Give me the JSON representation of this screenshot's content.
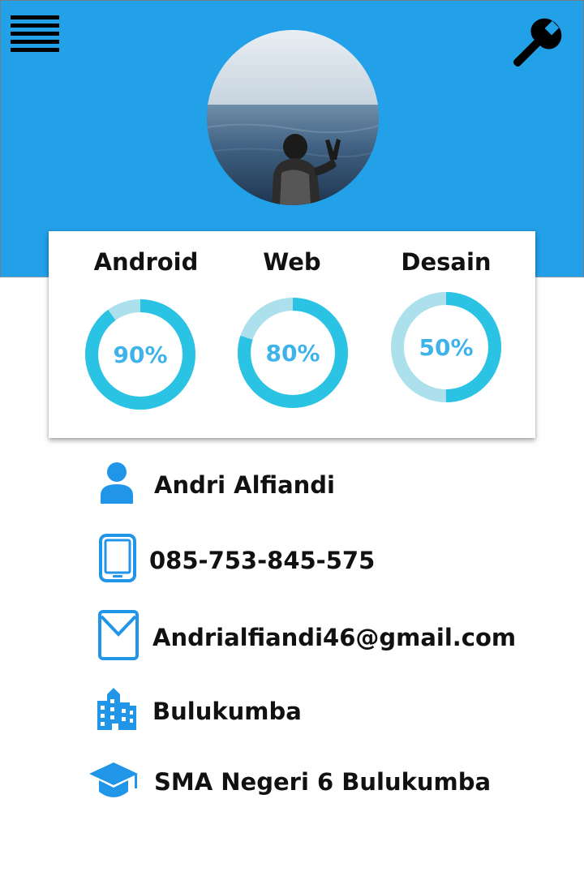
{
  "header": {
    "background_color": "#22a0e8",
    "menu_icon": "hamburger-menu-icon",
    "settings_icon": "wrench-icon",
    "avatar": "profile-photo"
  },
  "skills": {
    "accent_color": "#2bc3e3",
    "track_color": "#abe0ec",
    "value_color": "#3eb3ea",
    "items": [
      {
        "label": "Android",
        "value_text": "90%"
      },
      {
        "label": "Web",
        "value_text": "80%"
      },
      {
        "label": "Desain",
        "value_text": "50%"
      }
    ]
  },
  "profile": {
    "icon_color": "#2196e8",
    "name": {
      "icon": "person-icon",
      "text": "Andri Alfiandi"
    },
    "phone": {
      "icon": "phone-icon",
      "text": "085-753-845-575"
    },
    "email": {
      "icon": "mail-icon",
      "text": "Andrialfiandi46@gmail.com"
    },
    "city": {
      "icon": "city-building-icon",
      "text": "Bulukumba"
    },
    "school": {
      "icon": "graduation-cap-icon",
      "text": "SMA Negeri 6 Bulukumba"
    }
  }
}
